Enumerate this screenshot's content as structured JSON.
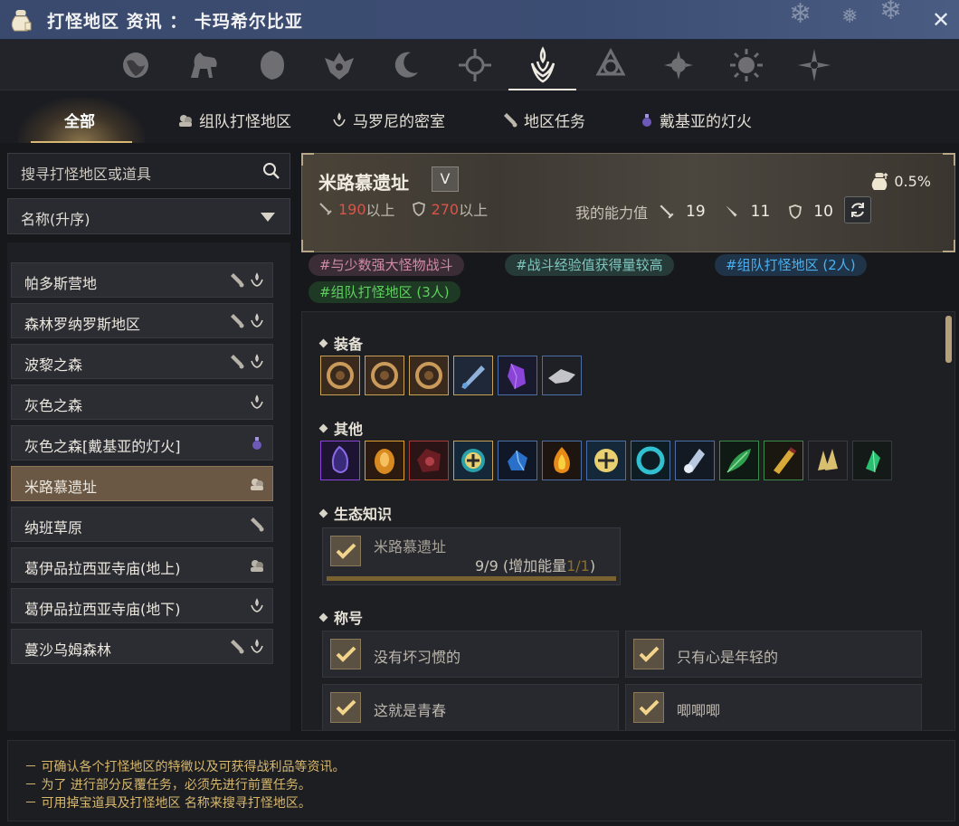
{
  "window": {
    "title": "打怪地区 资讯 ： 卡玛希尔比亚",
    "close_icon": "close-icon"
  },
  "category_icons": [
    "globe-icon",
    "horse-icon",
    "lion-icon",
    "crest-icon",
    "moon-icon",
    "orb-icon",
    "flame-emblem-icon",
    "triquetra-icon",
    "spiral-sun-icon",
    "sun-icon",
    "compass-star-icon"
  ],
  "tabs": {
    "all": "全部",
    "party": "组队打怪地区",
    "manoni": "马罗尼的密室",
    "quest": "地区任务",
    "dekia": "戴基亚的灯火"
  },
  "search": {
    "placeholder": "搜寻打怪地区或道具"
  },
  "sort": {
    "label": "名称(升序)"
  },
  "zones": [
    {
      "name": "帕多斯营地"
    },
    {
      "name": "森林罗纳罗斯地区"
    },
    {
      "name": "波黎之森"
    },
    {
      "name": "灰色之森"
    },
    {
      "name": "灰色之森[戴基亚的灯火]"
    },
    {
      "name": "米路慕遗址"
    },
    {
      "name": "纳班草原"
    },
    {
      "name": "葛伊品拉西亚寺庙(地上)"
    },
    {
      "name": "葛伊品拉西亚寺庙(地下)"
    },
    {
      "name": "蔓沙乌姆森林"
    }
  ],
  "detail": {
    "title": "米路慕遗址",
    "dropdown_glyph": "V",
    "rate": "0.5%",
    "req_ap": "190",
    "req_dp": "270",
    "req_suffix": "以上",
    "my_stats_label": "我的能力值",
    "ap": "19",
    "awaken_ap": "11",
    "dp": "10",
    "tags": [
      "#与少数强大怪物战斗",
      "#战斗经验值获得量较高",
      "#组队打怪地区 (2人)",
      "#组队打怪地区 (3人)"
    ],
    "sections": {
      "equipment": "装备",
      "others": "其他",
      "eco": "生态知识",
      "titles": "称号"
    },
    "eco_card": {
      "name": "米路慕遗址",
      "progress": "9/9",
      "bonus_prefix": "(增加能量",
      "bonus_value": "1/1",
      "bonus_suffix": ")"
    },
    "titles": [
      "没有坏习惯的",
      "只有心是年轻的",
      "这就是青春",
      "唧唧唧"
    ]
  },
  "footer": {
    "lines": [
      "－ 可确认各个打怪地区的特徵以及可获得战利品等资讯。",
      "－ 为了 进行部分反覆任务，必须先进行前置任务。",
      "－ 可用掉宝道具及打怪地区 名称来搜寻打怪地区。"
    ]
  },
  "colors": {
    "title_bar": "#3c4d73",
    "accent_gold": "#d8b674",
    "active_zone": "#6a5844",
    "req_red": "#d8554a",
    "tag_pink": "#d38aa6",
    "tag_teal": "#7fc6bf",
    "tag_blue": "#4ab0f0",
    "tag_green": "#5dd05d"
  }
}
